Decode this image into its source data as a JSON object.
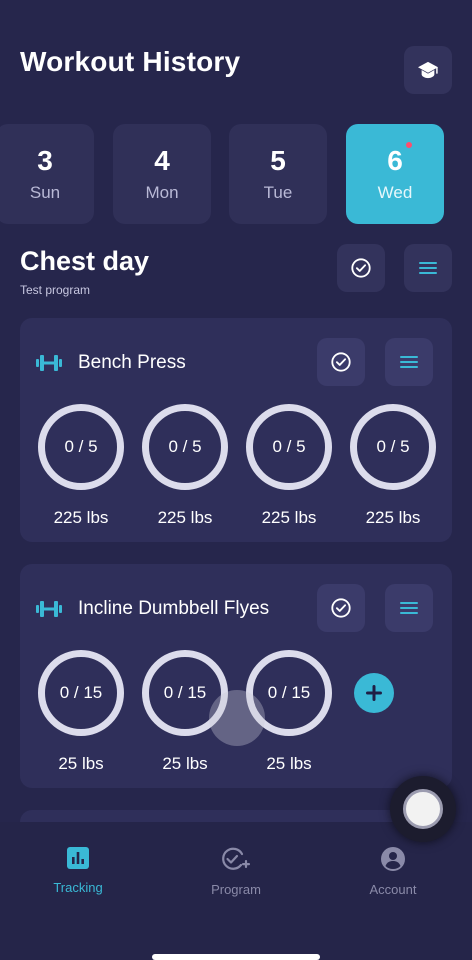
{
  "header": {
    "title": "Workout History",
    "learn_icon": "graduation-cap-icon"
  },
  "days": [
    {
      "num": "3",
      "dow": "Sun",
      "active": false
    },
    {
      "num": "4",
      "dow": "Mon",
      "active": false
    },
    {
      "num": "5",
      "dow": "Tue",
      "active": false
    },
    {
      "num": "6",
      "dow": "Wed",
      "active": true,
      "has_dot": true
    }
  ],
  "workout": {
    "title": "Chest day",
    "subtitle": "Test program"
  },
  "exercises": [
    {
      "name": "Bench Press",
      "sets": [
        {
          "reps": "0 / 5",
          "weight": "225 lbs"
        },
        {
          "reps": "0 / 5",
          "weight": "225 lbs"
        },
        {
          "reps": "0 / 5",
          "weight": "225 lbs"
        },
        {
          "reps": "0 / 5",
          "weight": "225 lbs"
        }
      ]
    },
    {
      "name": "Incline Dumbbell Flyes",
      "sets": [
        {
          "reps": "0 / 15",
          "weight": "25 lbs"
        },
        {
          "reps": "0 / 15",
          "weight": "25 lbs"
        },
        {
          "reps": "0 / 15",
          "weight": "25 lbs"
        }
      ],
      "has_add_button": true
    }
  ],
  "nav": [
    {
      "label": "Tracking",
      "icon": "bar-chart-icon",
      "active": true
    },
    {
      "label": "Program",
      "icon": "check-plus-icon",
      "active": false
    },
    {
      "label": "Account",
      "icon": "account-icon",
      "active": false
    }
  ],
  "colors": {
    "background": "#26264c",
    "card": "#2f2f5a",
    "accent": "#3ab9d6"
  }
}
